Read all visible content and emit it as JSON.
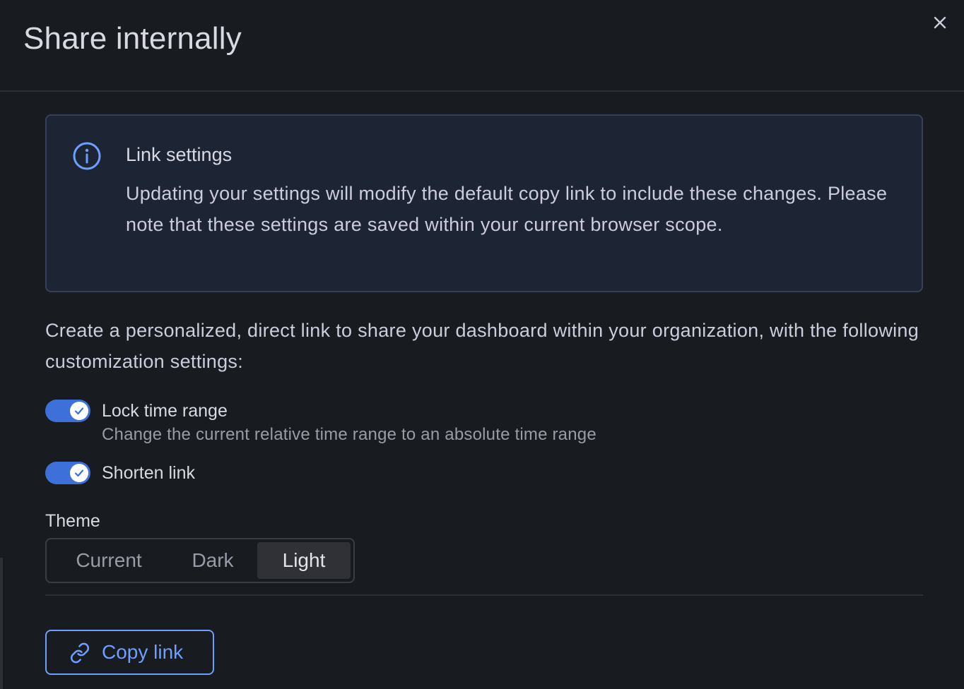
{
  "drawer": {
    "title": "Share internally",
    "close_icon": "close-icon"
  },
  "alert": {
    "icon": "info-circle-icon",
    "title": "Link settings",
    "body": "Updating your settings will modify the default copy link to include these changes. Please note that these settings are saved within your current browser scope."
  },
  "description": "Create a personalized, direct link to share your dashboard within your organization, with the following customization settings:",
  "toggles": [
    {
      "label": "Lock time range",
      "description": "Change the current relative time range to an absolute time range",
      "checked": true
    },
    {
      "label": "Shorten link",
      "checked": true
    }
  ],
  "theme": {
    "label": "Theme",
    "options": [
      "Current",
      "Dark",
      "Light"
    ],
    "selected": "Light"
  },
  "copy_button": {
    "icon": "link-icon",
    "label": "Copy link"
  },
  "colors": {
    "background": "#181b1f",
    "accent": "#3d71d9",
    "link": "#6e9fff",
    "alert_bg": "#1d2535"
  }
}
